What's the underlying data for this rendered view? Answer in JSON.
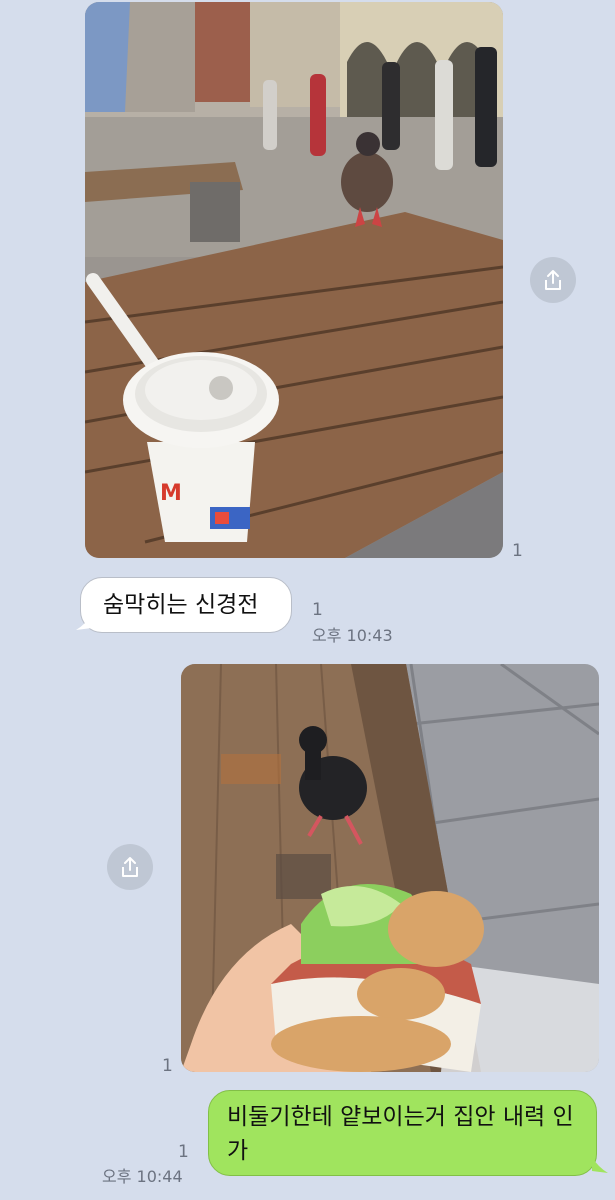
{
  "messages": [
    {
      "type": "image",
      "direction": "received",
      "image_desc": "pigeon-table-photo",
      "read_count": "1"
    },
    {
      "type": "text",
      "direction": "received",
      "text": "숨막히는 신경전",
      "read_count": "1",
      "time": "오후 10:43"
    },
    {
      "type": "image",
      "direction": "sent",
      "image_desc": "pigeon-sandwich-photo",
      "read_count": "1"
    },
    {
      "type": "text",
      "direction": "sent",
      "text": "비둘기한테 얕보이는거 집안 내력 인가",
      "read_count": "1",
      "time": "오후 10:44"
    }
  ],
  "icons": {
    "share": "share-icon",
    "logo": "mcdonalds-logo"
  },
  "colors": {
    "background": "#d5ddec",
    "sent_bubble": "#a0e45e",
    "received_bubble": "#ffffff",
    "share_button": "#bfc7d4"
  }
}
